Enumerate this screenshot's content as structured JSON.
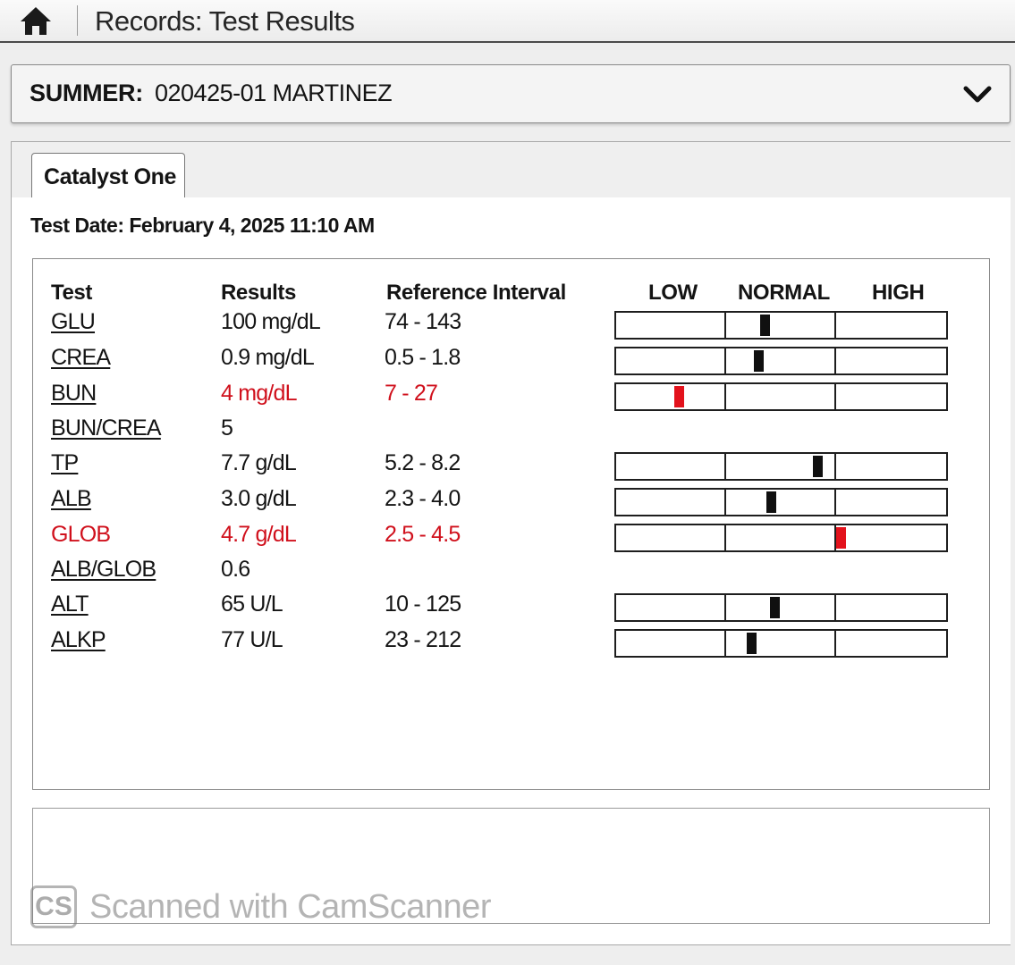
{
  "header": {
    "title": "Records: Test Results",
    "home_icon": "home-icon"
  },
  "patient": {
    "label": "SUMMER:",
    "value": "020425-01 MARTINEZ",
    "expand_icon": "chevron-down-icon"
  },
  "tabs": [
    {
      "label": "Catalyst One",
      "active": true
    }
  ],
  "test_date": "Test Date: February 4, 2025 11:10 AM",
  "columns": {
    "test": "Test",
    "results": "Results",
    "reference": "Reference Interval",
    "low": "LOW",
    "normal": "NORMAL",
    "high": "HIGH"
  },
  "rows": [
    {
      "test": "GLU",
      "result": "100 mg/dL",
      "reference": "74 - 143",
      "status": "normal",
      "marker": 0.45
    },
    {
      "test": "CREA",
      "result": "0.9 mg/dL",
      "reference": "0.5 - 1.8",
      "status": "normal",
      "marker": 0.43
    },
    {
      "test": "BUN",
      "result": "4 mg/dL",
      "reference": "7 - 27",
      "status": "low",
      "marker": 0.19
    },
    {
      "test": "BUN/CREA",
      "result": "5",
      "reference": "",
      "status": "none"
    },
    {
      "test": "TP",
      "result": "7.7 g/dL",
      "reference": "5.2 - 8.2",
      "status": "normal",
      "marker": 0.61
    },
    {
      "test": "ALB",
      "result": "3.0 g/dL",
      "reference": "2.3 - 4.0",
      "status": "normal",
      "marker": 0.47
    },
    {
      "test": "GLOB",
      "result": "4.7 g/dL",
      "reference": "2.5 - 4.5",
      "status": "high",
      "marker": 0.68
    },
    {
      "test": "ALB/GLOB",
      "result": "0.6",
      "reference": "",
      "status": "none"
    },
    {
      "test": "ALT",
      "result": "65 U/L",
      "reference": "10 - 125",
      "status": "normal",
      "marker": 0.48
    },
    {
      "test": "ALKP",
      "result": "77 U/L",
      "reference": "23 - 212",
      "status": "normal",
      "marker": 0.41
    }
  ],
  "colors": {
    "abnormal": "#d0101c",
    "marker_normal": "#101010",
    "marker_abnormal": "#e3121c"
  },
  "watermark": {
    "logo": "CS",
    "text": "Scanned with CamScanner"
  }
}
